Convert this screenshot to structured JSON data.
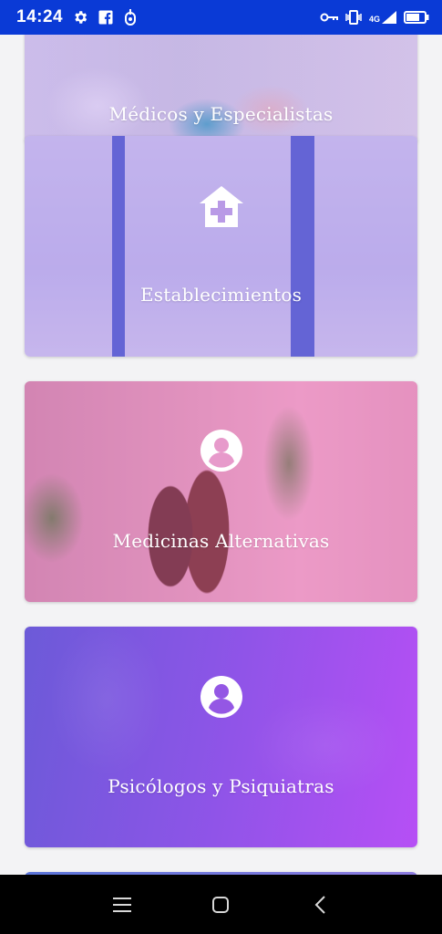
{
  "status_bar": {
    "time": "14:24",
    "network": "4G",
    "icons": [
      "gear-icon",
      "facebook-icon",
      "notification-icon",
      "vpn-key-icon",
      "vibrate-icon",
      "signal-icon",
      "battery-icon"
    ]
  },
  "cards": [
    {
      "label": "Médicos y Especialistas",
      "icon": "doctor-photo"
    },
    {
      "label": "Establecimientos",
      "icon": "hospital-icon"
    },
    {
      "label": "Medicinas Alternativas",
      "icon": "account-circle-icon"
    },
    {
      "label": "Psicólogos y Psiquiatras",
      "icon": "account-circle-icon"
    }
  ],
  "nav_bar": {
    "icons": [
      "menu-icon",
      "home-icon",
      "back-icon"
    ]
  },
  "colors": {
    "status_bar": "#0a3ad6",
    "background": "#f3f3f5",
    "nav_bar": "#000000",
    "card_gradient_start": "#6c5ad8",
    "card_gradient_end": "#b64ff5"
  }
}
